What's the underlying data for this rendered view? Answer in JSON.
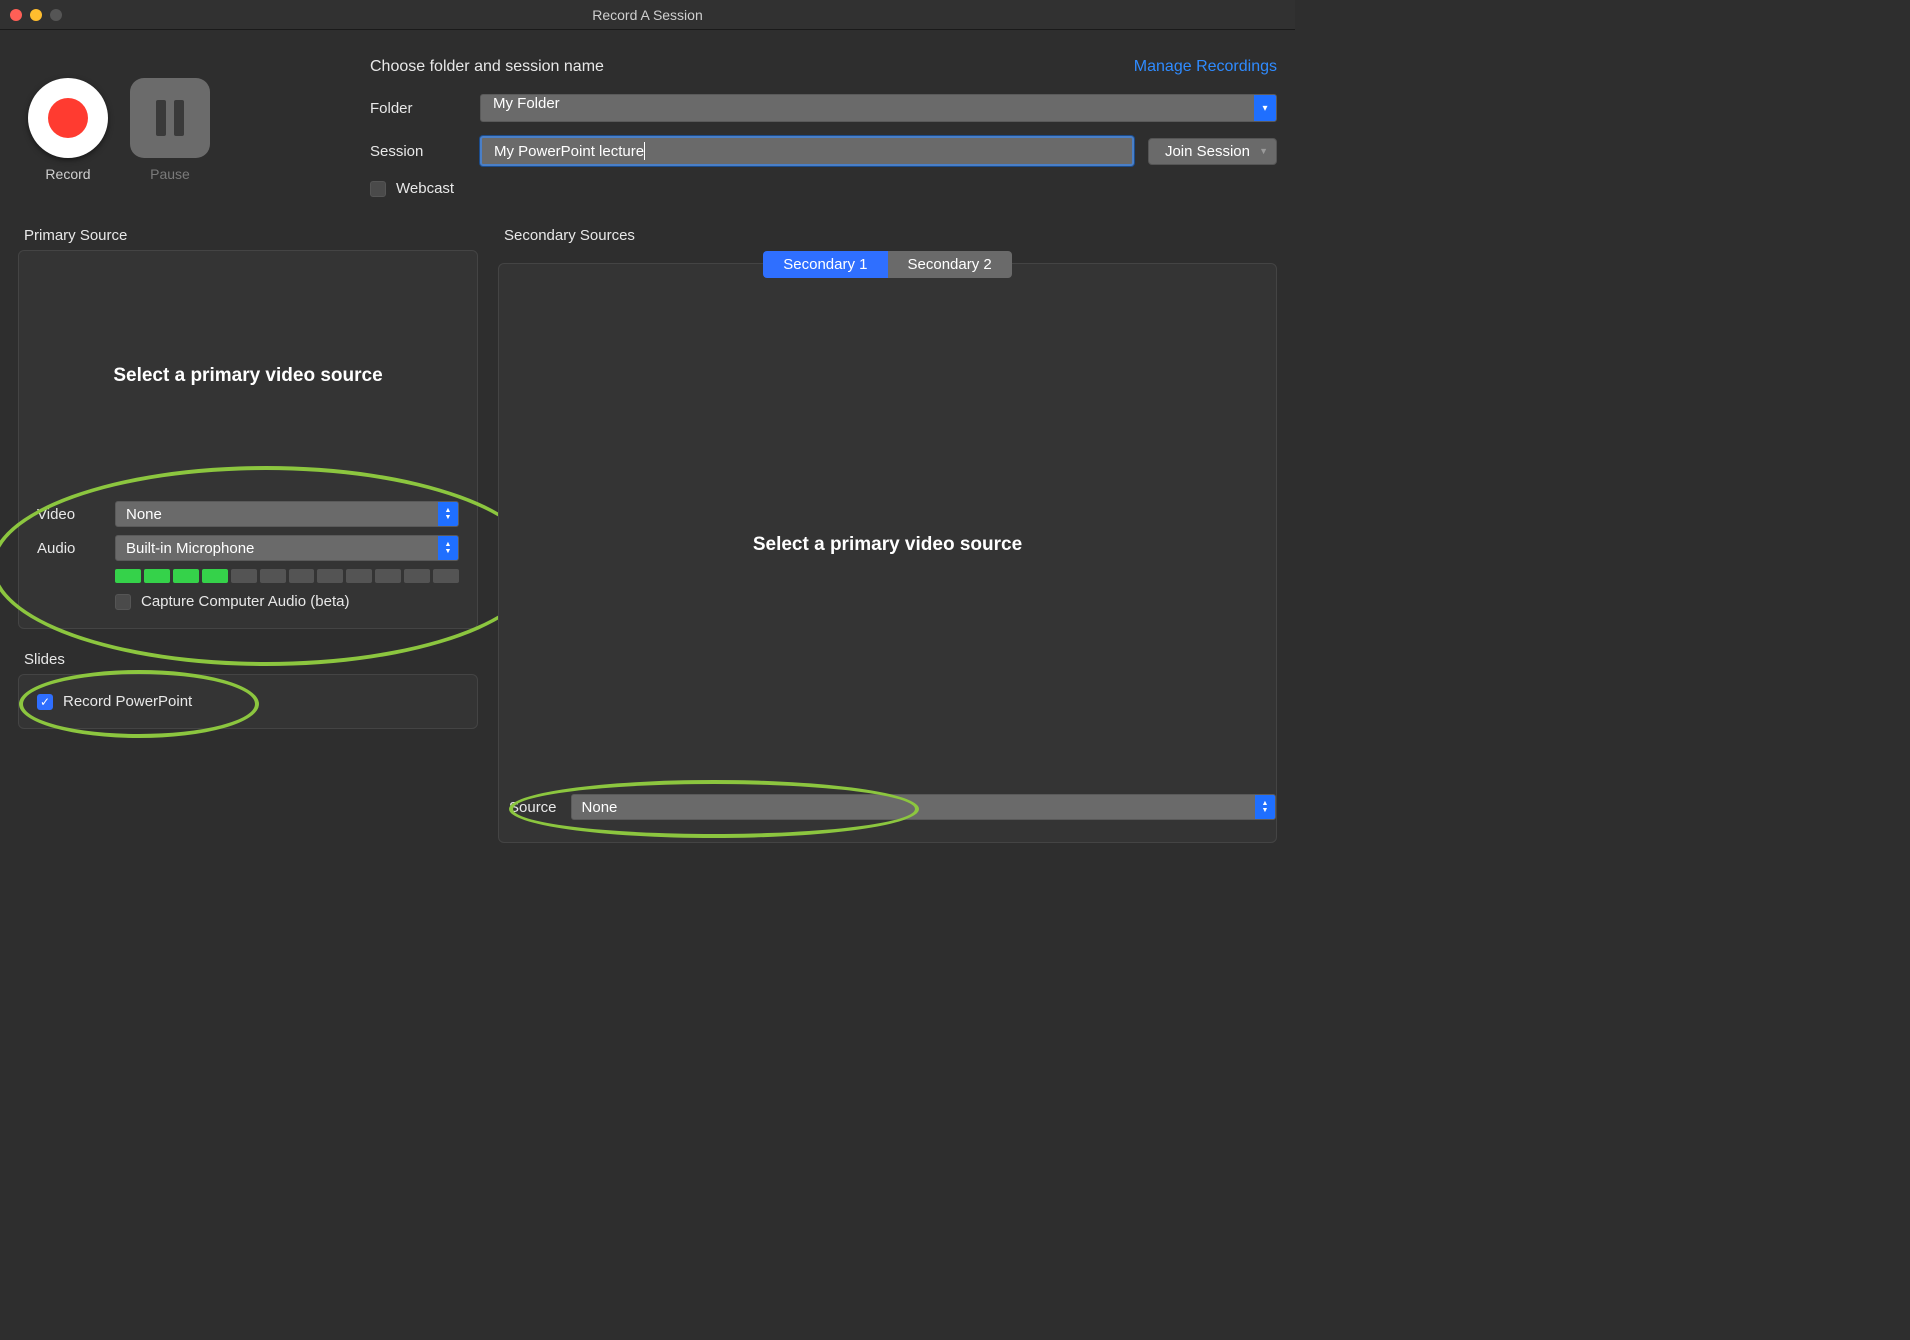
{
  "window": {
    "title": "Record A Session"
  },
  "controls": {
    "record": "Record",
    "pause": "Pause"
  },
  "form": {
    "header": "Choose folder and session name",
    "manage_link": "Manage Recordings",
    "folder_label": "Folder",
    "folder_value": "My Folder",
    "session_label": "Session",
    "session_value": "My PowerPoint lecture",
    "join_button": "Join Session",
    "webcast_label": "Webcast"
  },
  "primary": {
    "section": "Primary Source",
    "placeholder": "Select a primary video source",
    "video_label": "Video",
    "video_value": "None",
    "audio_label": "Audio",
    "audio_value": "Built-in Microphone",
    "capture_label": "Capture Computer Audio (beta)",
    "level_segments_on": 4,
    "level_segments_total": 12
  },
  "slides": {
    "section": "Slides",
    "record_pp_label": "Record PowerPoint",
    "record_pp_checked": true
  },
  "secondary": {
    "section": "Secondary Sources",
    "tab1": "Secondary 1",
    "tab2": "Secondary 2",
    "placeholder": "Select a primary video source",
    "source_label": "Source",
    "source_value": "None"
  }
}
